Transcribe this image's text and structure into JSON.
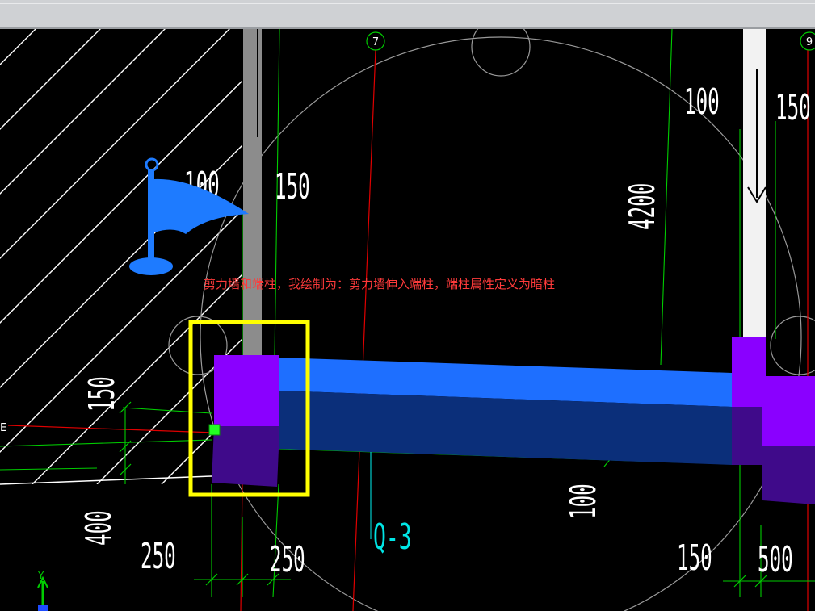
{
  "colors": {
    "background": "#000000",
    "grid_line": "#e00000",
    "dim_line": "#00cc00",
    "wall": "#1e6fff",
    "wall_dark": "#0b2f7a",
    "column": "#8a00ff",
    "column_dark": "#3f0a8a",
    "highlight_box": "#ffff00",
    "note_text": "#ff3b3b",
    "label_text": "#00e5e5",
    "flag": "#1e7bff"
  },
  "axes": {
    "axis_7": "7",
    "axis_9": "9",
    "axis_e": "E",
    "ucs_y": "Y"
  },
  "dimensions": {
    "top_left_100": "100",
    "top_left_150": "150",
    "top_right_100": "100",
    "top_right_150": "150",
    "vertical_4200": "4200",
    "left_150": "150",
    "left_400": "400",
    "bottom_250_a": "250",
    "bottom_250_b": "250",
    "bottom_100": "100",
    "bottom_150": "150",
    "bottom_500": "500"
  },
  "labels": {
    "wall_label": "Q-3",
    "note": "剪力墙和端柱，我绘制为：剪力墙伸入端柱，端柱属性定义为暗柱"
  },
  "icons": {
    "flag": "flag-marker-icon",
    "grip": "grip-point-icon",
    "direction_arrow": "arrow-down-icon",
    "ucs": "ucs-axis-icon"
  }
}
